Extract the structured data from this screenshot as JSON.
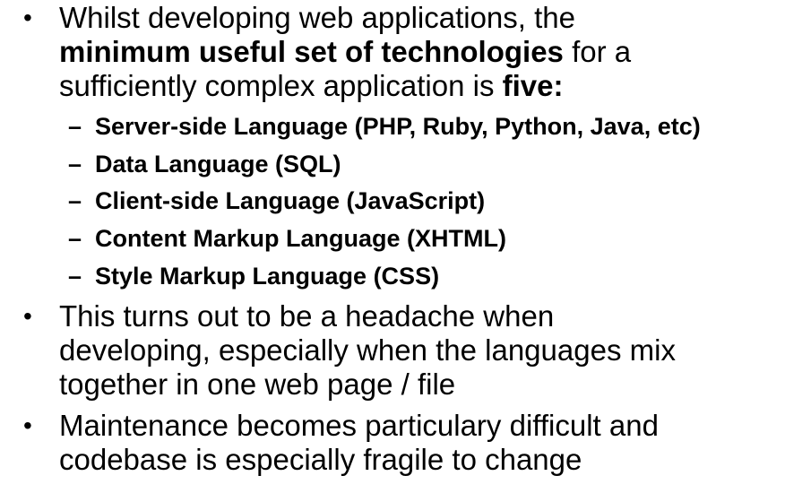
{
  "bullet_symbol": "•",
  "dash_symbol": "–",
  "bullet1": {
    "line1": "Whilst developing web applications, the",
    "line2_bold": "minimum useful set of technologies",
    "line2_rest": " for a",
    "line3_plain": "sufficiently complex application is ",
    "line3_bold": "five:"
  },
  "subitems": [
    "Server-side Language (PHP, Ruby, Python, Java, etc)",
    "Data Language (SQL)",
    "Client-side Language (JavaScript)",
    "Content Markup Language (XHTML)",
    "Style Markup Language (CSS)"
  ],
  "bullet2": {
    "line1": "This turns out to be a headache when",
    "line2": "developing, especially when the languages mix",
    "line3": "together in one web page / file"
  },
  "bullet3": {
    "line1": "Maintenance becomes particulary difficult and",
    "line2": "codebase is especially fragile to change"
  }
}
